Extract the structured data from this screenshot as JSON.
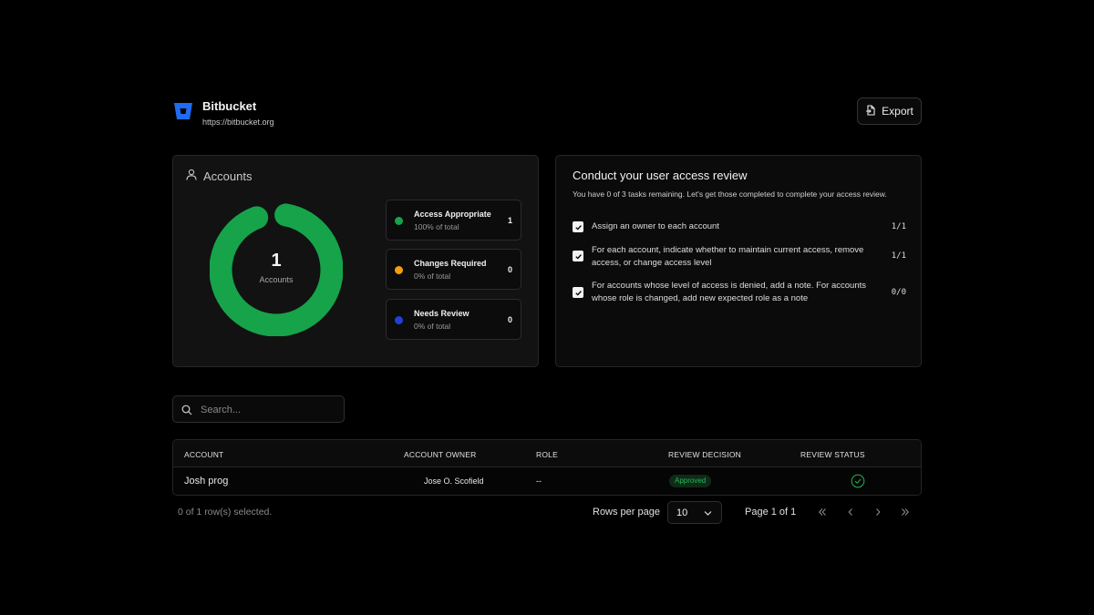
{
  "app": {
    "title": "Bitbucket",
    "url": "https://bitbucket.org",
    "logo_icon": "bitbucket-logo"
  },
  "toolbar": {
    "export_label": "Export",
    "export_icon": "file-export-icon"
  },
  "accounts": {
    "title": "Accounts",
    "total": "1",
    "total_label": "Accounts",
    "stats": [
      {
        "name": "Access Appropriate",
        "percent_text": "100% of total",
        "count": "1",
        "color": "#16a34a"
      },
      {
        "name": "Changes Required",
        "percent_text": "0% of total",
        "count": "0",
        "color": "#f59e0b"
      },
      {
        "name": "Needs Review",
        "percent_text": "0% of total",
        "count": "0",
        "color": "#2140d9"
      }
    ],
    "donut_fraction_appropriate": 1.0
  },
  "review": {
    "title": "Conduct your user access review",
    "description": "You have 0 of 3 tasks remaining. Let's get those completed to complete your access review.",
    "tasks": [
      {
        "text": "Assign an owner to each account",
        "progress": "1/1",
        "checked": true
      },
      {
        "text": "For each account, indicate whether to maintain current access, remove access, or change access level",
        "progress": "1/1",
        "checked": true
      },
      {
        "text": "For accounts whose level of access is denied, add a note. For accounts whose role is changed, add new expected role as a note",
        "progress": "0/0",
        "checked": true
      }
    ]
  },
  "search": {
    "placeholder": "Search..."
  },
  "table": {
    "headers": [
      "ACCOUNT",
      "ACCOUNT OWNER",
      "ROLE",
      "REVIEW DECISION",
      "REVIEW STATUS"
    ],
    "rows": [
      {
        "account": "Josh prog",
        "owner": "Jose O. Scofield",
        "role": "--",
        "decision": "Approved",
        "status_icon": "check-circle-icon"
      }
    ]
  },
  "footer": {
    "rows_selected": "0 of 1 row(s) selected.",
    "rows_per_page_label": "Rows per page",
    "rows_per_page_value": "10",
    "page_info": "Page 1 of 1"
  }
}
